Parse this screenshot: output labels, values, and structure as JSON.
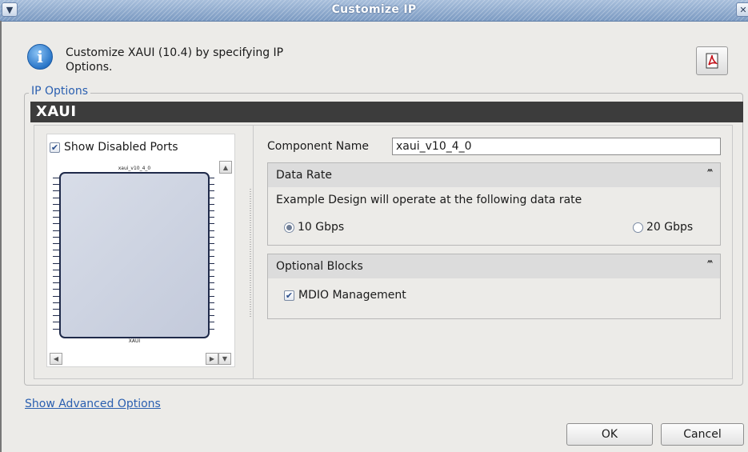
{
  "window": {
    "title": "Customize IP",
    "menu_icon": "chevron-down-icon",
    "close_icon": "close-icon"
  },
  "header": {
    "description": "Customize XAUI (10.4) by specifying IP Options.",
    "info_icon": "info-icon",
    "pdf_icon": "pdf-icon"
  },
  "ip_options": {
    "group_label": "IP Options",
    "core_name": "XAUI",
    "symbol": {
      "show_disabled_ports_label": "Show Disabled Ports",
      "show_disabled_ports_checked": true,
      "instance_label": "xaui_v10_4_0",
      "block_label": "XAUI"
    },
    "component_name_label": "Component Name",
    "component_name_value": "xaui_v10_4_0",
    "data_rate": {
      "title": "Data Rate",
      "description": "Example Design will operate at the following data rate",
      "options": [
        {
          "label": "10 Gbps",
          "selected": true
        },
        {
          "label": "20 Gbps",
          "selected": false
        }
      ]
    },
    "optional_blocks": {
      "title": "Optional Blocks",
      "mdio_label": "MDIO Management",
      "mdio_checked": true
    }
  },
  "footer": {
    "advanced_link": "Show Advanced Options",
    "ok_label": "OK",
    "cancel_label": "Cancel"
  }
}
